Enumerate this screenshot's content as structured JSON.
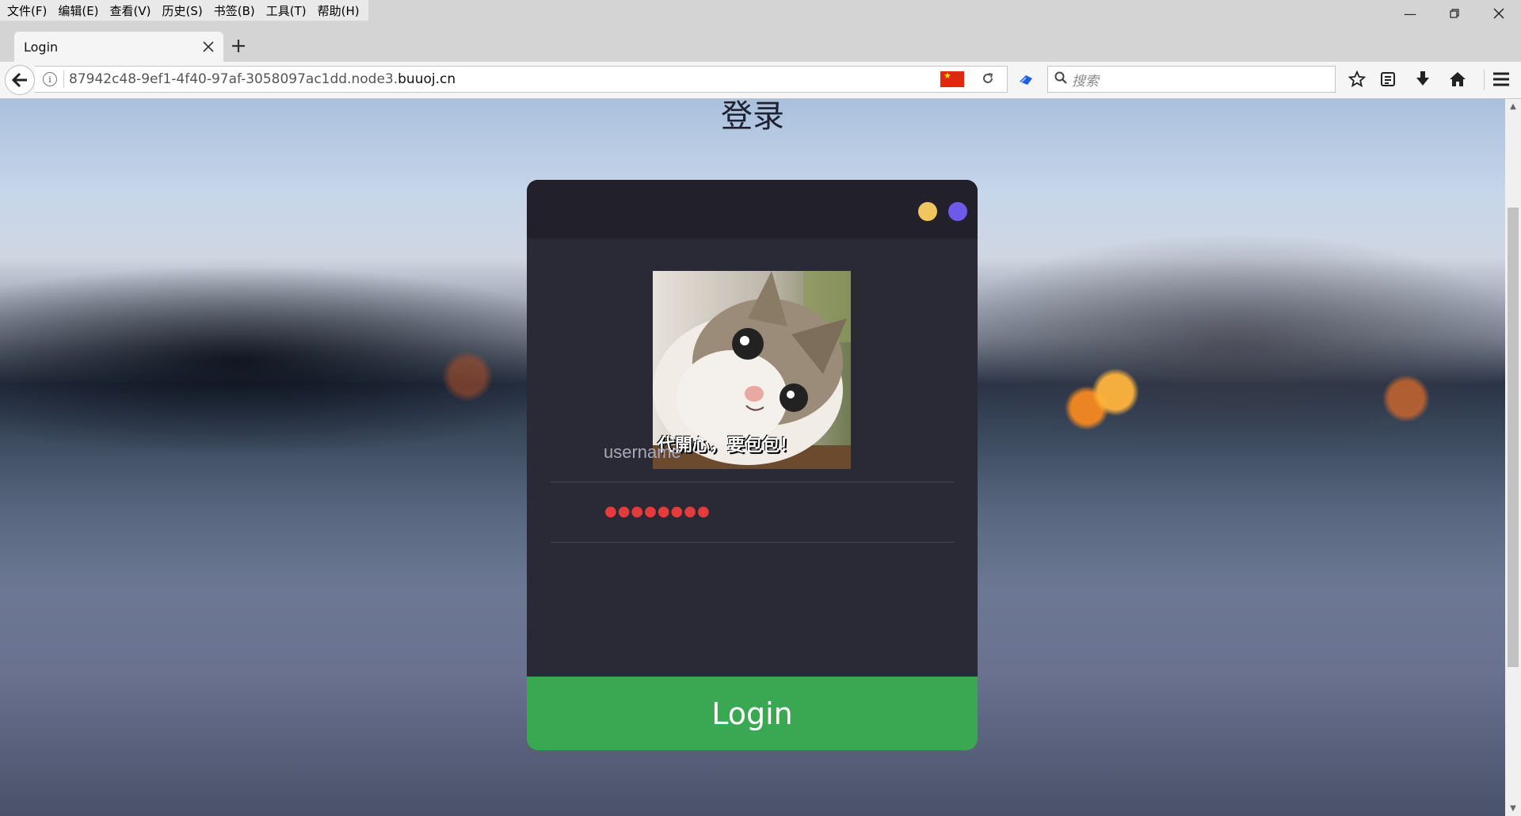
{
  "menubar": {
    "items": [
      "文件(F)",
      "编辑(E)",
      "查看(V)",
      "历史(S)",
      "书签(B)",
      "工具(T)",
      "帮助(H)"
    ]
  },
  "tab": {
    "title": "Login"
  },
  "address": {
    "url_prefix": "87942c48-9ef1-4f40-97af-3058097ac1dd.node3.",
    "url_domain": "buuoj.cn"
  },
  "search": {
    "placeholder": "搜索"
  },
  "page": {
    "title": "登录",
    "avatar_caption": "代開心，要包包！",
    "username_placeholder": "username",
    "password_value": "●●●●●●●●",
    "login_label": "Login"
  },
  "colors": {
    "card_bg": "#2a2936",
    "card_header": "#22212b",
    "dot_yellow": "#f0c75e",
    "dot_purple": "#6d5ae8",
    "login_button": "#3aa852",
    "password_dots": "#e23c3c"
  },
  "icons": [
    "back-arrow-icon",
    "info-icon",
    "china-flag-icon",
    "reload-icon",
    "extension-icon",
    "search-icon",
    "star-icon",
    "reading-list-icon",
    "download-icon",
    "home-icon",
    "hamburger-menu-icon",
    "close-icon",
    "plus-icon"
  ]
}
